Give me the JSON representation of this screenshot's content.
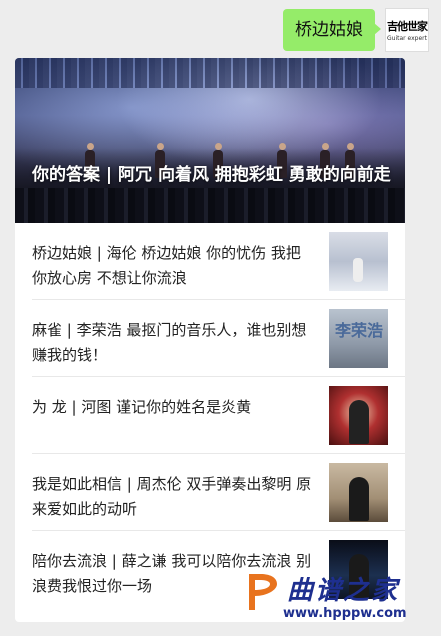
{
  "message": {
    "text": "桥边姑娘"
  },
  "avatar": {
    "sig": "吉他世家",
    "sub": "Guitar expert",
    "icon": "brand-logo"
  },
  "cover": {
    "title": "你的答案 | 阿冗 向着风 拥抱彩虹 勇敢的向前走"
  },
  "list": [
    {
      "title": "桥边姑娘 | 海伦 桥边姑娘 你的忧伤 我把你放心房 不想让你流浪",
      "thumb": "singer-thumbnail"
    },
    {
      "title": "麻雀 | 李荣浩  最抠门的音乐人，谁也别想赚我的钱！",
      "thumb": "album-thumbnail",
      "thumb_mark": "李荣浩"
    },
    {
      "title": "为 龙 | 河图  谨记你的姓名是炎黄",
      "thumb": "singer-thumbnail"
    },
    {
      "title": "我是如此相信 | 周杰伦  双手弹奏出黎明 原来爱如此的动听",
      "thumb": "singer-thumbnail"
    },
    {
      "title": "陪你去流浪 | 薛之谦 我可以陪你去流浪 别浪费我恨过你一场",
      "thumb": "singer-thumbnail"
    }
  ],
  "watermark": {
    "cn": "曲谱之家",
    "en": "www.hpppw.com",
    "accent": "#1e2f8f",
    "logo_orange": "#e8731e"
  }
}
